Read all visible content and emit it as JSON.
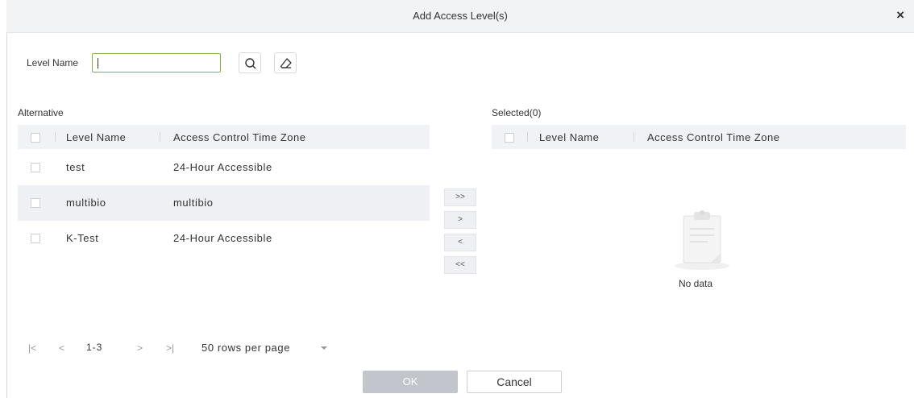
{
  "dialog": {
    "title": "Add Access Level(s)",
    "close_icon": "close-icon"
  },
  "search": {
    "label": "Level Name",
    "value": "",
    "search_icon": "search-icon",
    "clear_icon": "eraser-icon"
  },
  "alternative": {
    "title": "Alternative",
    "columns": [
      "Level Name",
      "Access Control Time Zone"
    ],
    "rows": [
      {
        "name": "test",
        "zone": "24-Hour Accessible",
        "selected": false
      },
      {
        "name": "multibio",
        "zone": "multibio",
        "selected": true
      },
      {
        "name": "K-Test",
        "zone": "24-Hour Accessible",
        "selected": false
      }
    ]
  },
  "transfer": {
    "all_right": ">>",
    "right": ">",
    "left": "<",
    "all_left": "<<"
  },
  "selected": {
    "title": "Selected(0)",
    "columns": [
      "Level Name",
      "Access Control Time Zone"
    ],
    "empty_text": "No data"
  },
  "pagination": {
    "first": "|<",
    "prev": "<",
    "range": "1-3",
    "next": ">",
    "last": ">|",
    "rows_per_page": "50 rows per page"
  },
  "footer": {
    "ok": "OK",
    "cancel": "Cancel"
  }
}
